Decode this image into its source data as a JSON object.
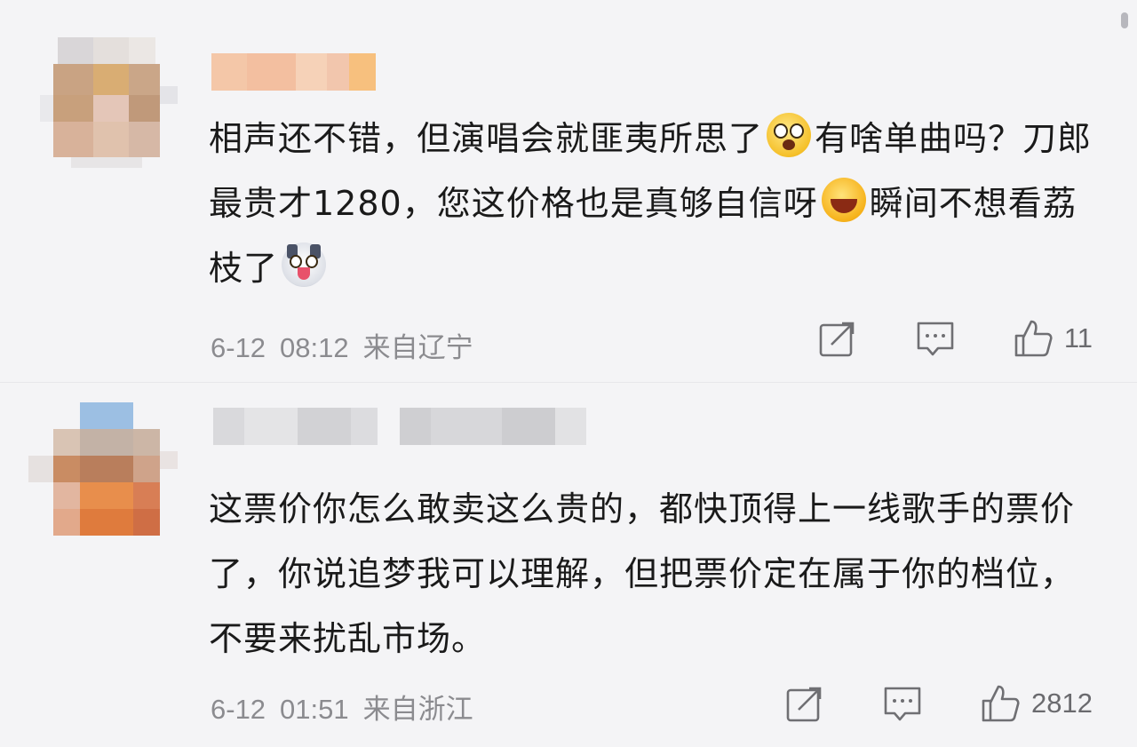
{
  "comments": [
    {
      "text_parts": [
        "相声还不错，但演唱会就匪夷所思了",
        "有啥单曲吗？刀郎最贵才1280，您这价格也是真够自信呀",
        "瞬间不想看荔枝了"
      ],
      "emojis": [
        "shock-emoji",
        "laugh-emoji",
        "husky-dog-emoji"
      ],
      "date": "6-12",
      "time": "08:12",
      "location": "来自辽宁",
      "likes": "11",
      "icons": [
        "share-icon",
        "comment-icon",
        "like-icon"
      ]
    },
    {
      "text": "这票价你怎么敢卖这么贵的，都快顶得上一线歌手的票价了，你说追梦我可以理解，但把票价定在属于你的档位，不要来扰乱市场。",
      "date": "6-12",
      "time": "01:51",
      "location": "来自浙江",
      "likes": "2812",
      "icons": [
        "share-icon",
        "comment-icon",
        "like-icon"
      ]
    }
  ],
  "colors": {
    "background": "#f4f4f6",
    "text": "#1a1a1a",
    "meta": "#8b8b8f"
  }
}
